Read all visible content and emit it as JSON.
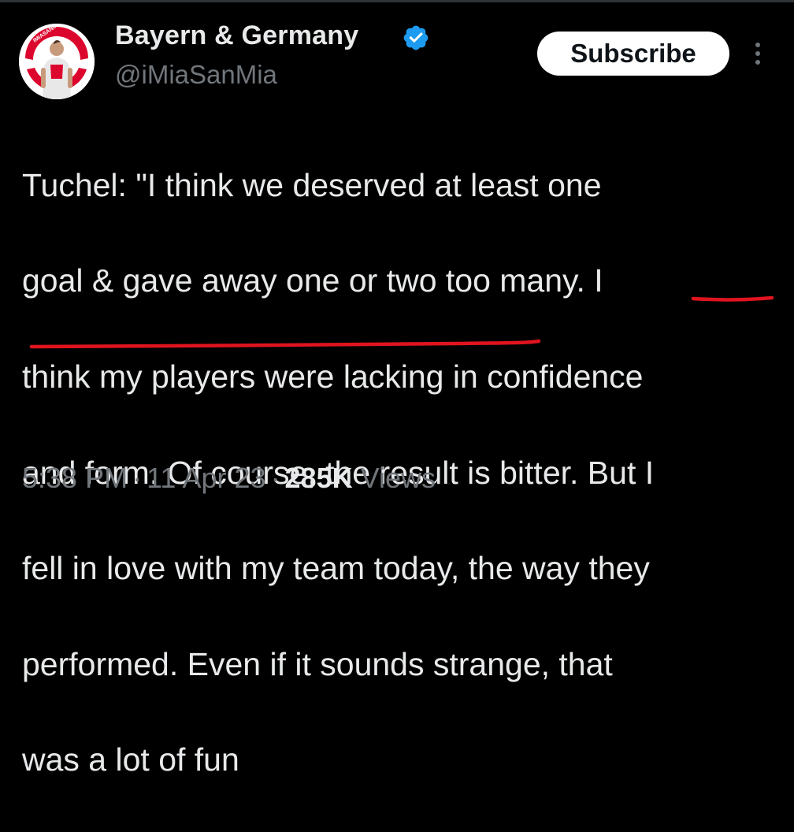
{
  "author": {
    "name": "Bayern & Germany",
    "handle": "@iMiaSanMia",
    "avatar_logo_text": "IMIASANMIA",
    "verified_color": "#1d9bf0"
  },
  "actions": {
    "subscribe_label": "Subscribe",
    "more_icon": "more-vertical-icon"
  },
  "tweet": {
    "lines": [
      "Tuchel: \"I think we deserved at least one",
      "goal & gave away one or two too many. I",
      "think my players were lacking in confidence",
      "and form. Of course, the result is bitter. But I",
      "fell in love with my team today, the way they",
      "performed. Even if it sounds strange, that",
      "was a lot of fun"
    ],
    "annotation": {
      "type": "hand-drawn underline",
      "color": "#e0141e",
      "underlined_text": "But I fell in love with my team today,"
    }
  },
  "meta": {
    "time": "5:38 PM",
    "separator": "·",
    "date": "11 Apr 23",
    "views_count": "285K",
    "views_label": "Views"
  },
  "colors": {
    "background": "#000000",
    "text_primary": "#e7e9ea",
    "text_secondary": "#71767b",
    "button_bg": "#ffffff"
  }
}
